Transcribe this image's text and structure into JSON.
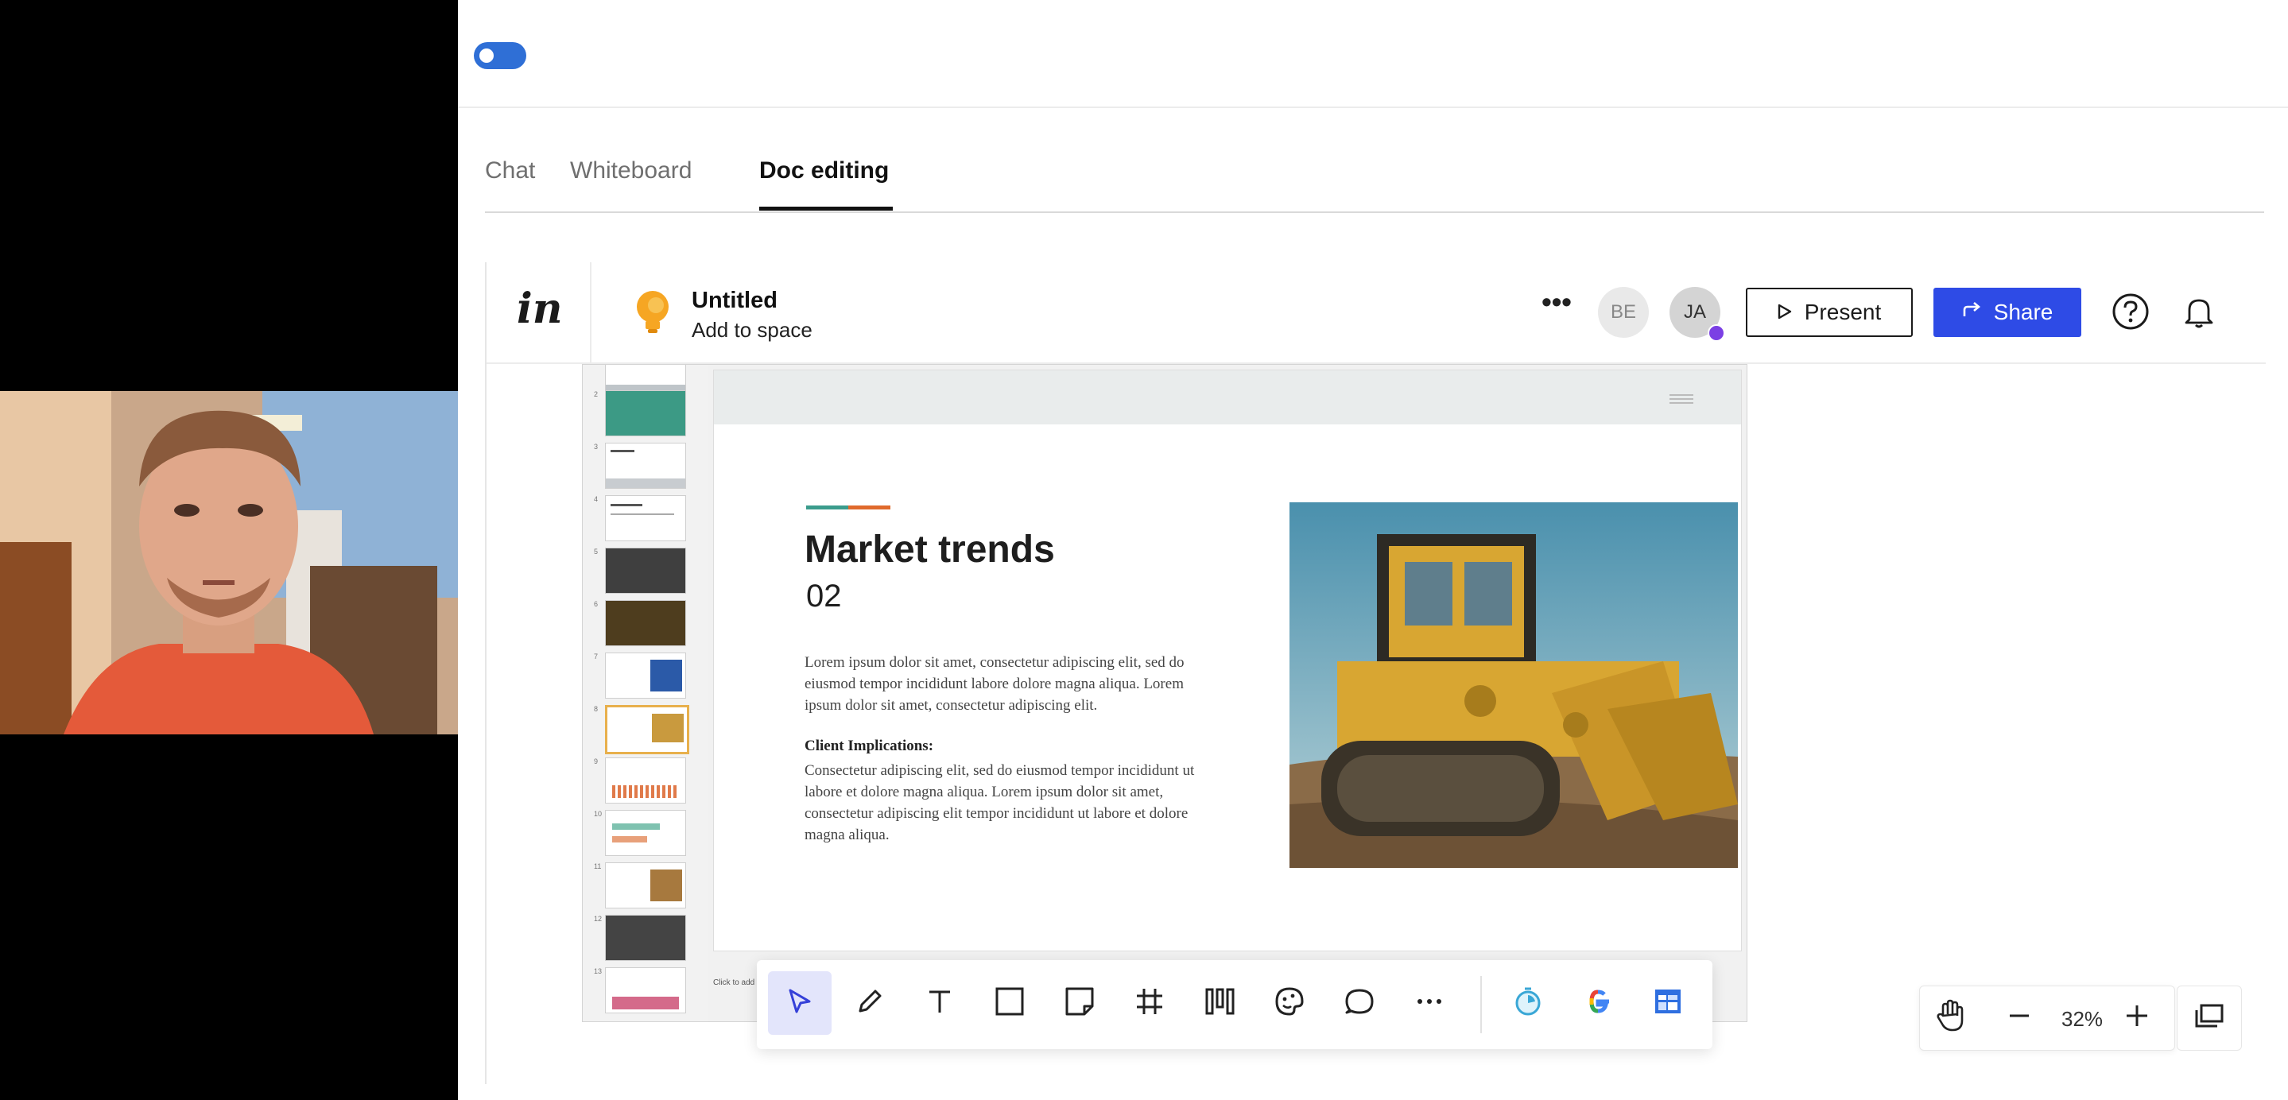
{
  "meeting": {
    "tabs": [
      {
        "label": "Chat"
      },
      {
        "label": "Whiteboard"
      },
      {
        "label": "Doc editing"
      }
    ]
  },
  "app": {
    "logo": "in",
    "doc_title": "Untitled",
    "doc_subtitle": "Add to space",
    "avatars": [
      {
        "initials": "BE"
      },
      {
        "initials": "JA"
      }
    ],
    "present_label": "Present",
    "share_label": "Share"
  },
  "slide": {
    "title": "Market trends",
    "number": "02",
    "body": "Lorem ipsum dolor sit amet, consectetur adipiscing elit, sed do eiusmod tempor incididunt labore dolore magna aliqua. Lorem ipsum dolor sit amet, consectetur adipiscing elit.",
    "heading2": "Client Implications:",
    "body2": "Consectetur adipiscing elit, sed do eiusmod tempor incididunt ut labore et dolore magna aliqua. Lorem ipsum dolor sit amet, consectetur adipiscing elit tempor incididunt ut labore et dolore magna aliqua.",
    "speaker_notes_placeholder": "Click to add sp",
    "thumbnail_numbers": [
      "2",
      "3",
      "4",
      "5",
      "6",
      "7",
      "8",
      "9",
      "10",
      "11",
      "12",
      "13"
    ]
  },
  "zoom": {
    "level": "32%"
  },
  "colors": {
    "accent_blue": "#2e4be6",
    "toggle_blue": "#2f6fd6",
    "presence_purple": "#7b3fe4"
  }
}
